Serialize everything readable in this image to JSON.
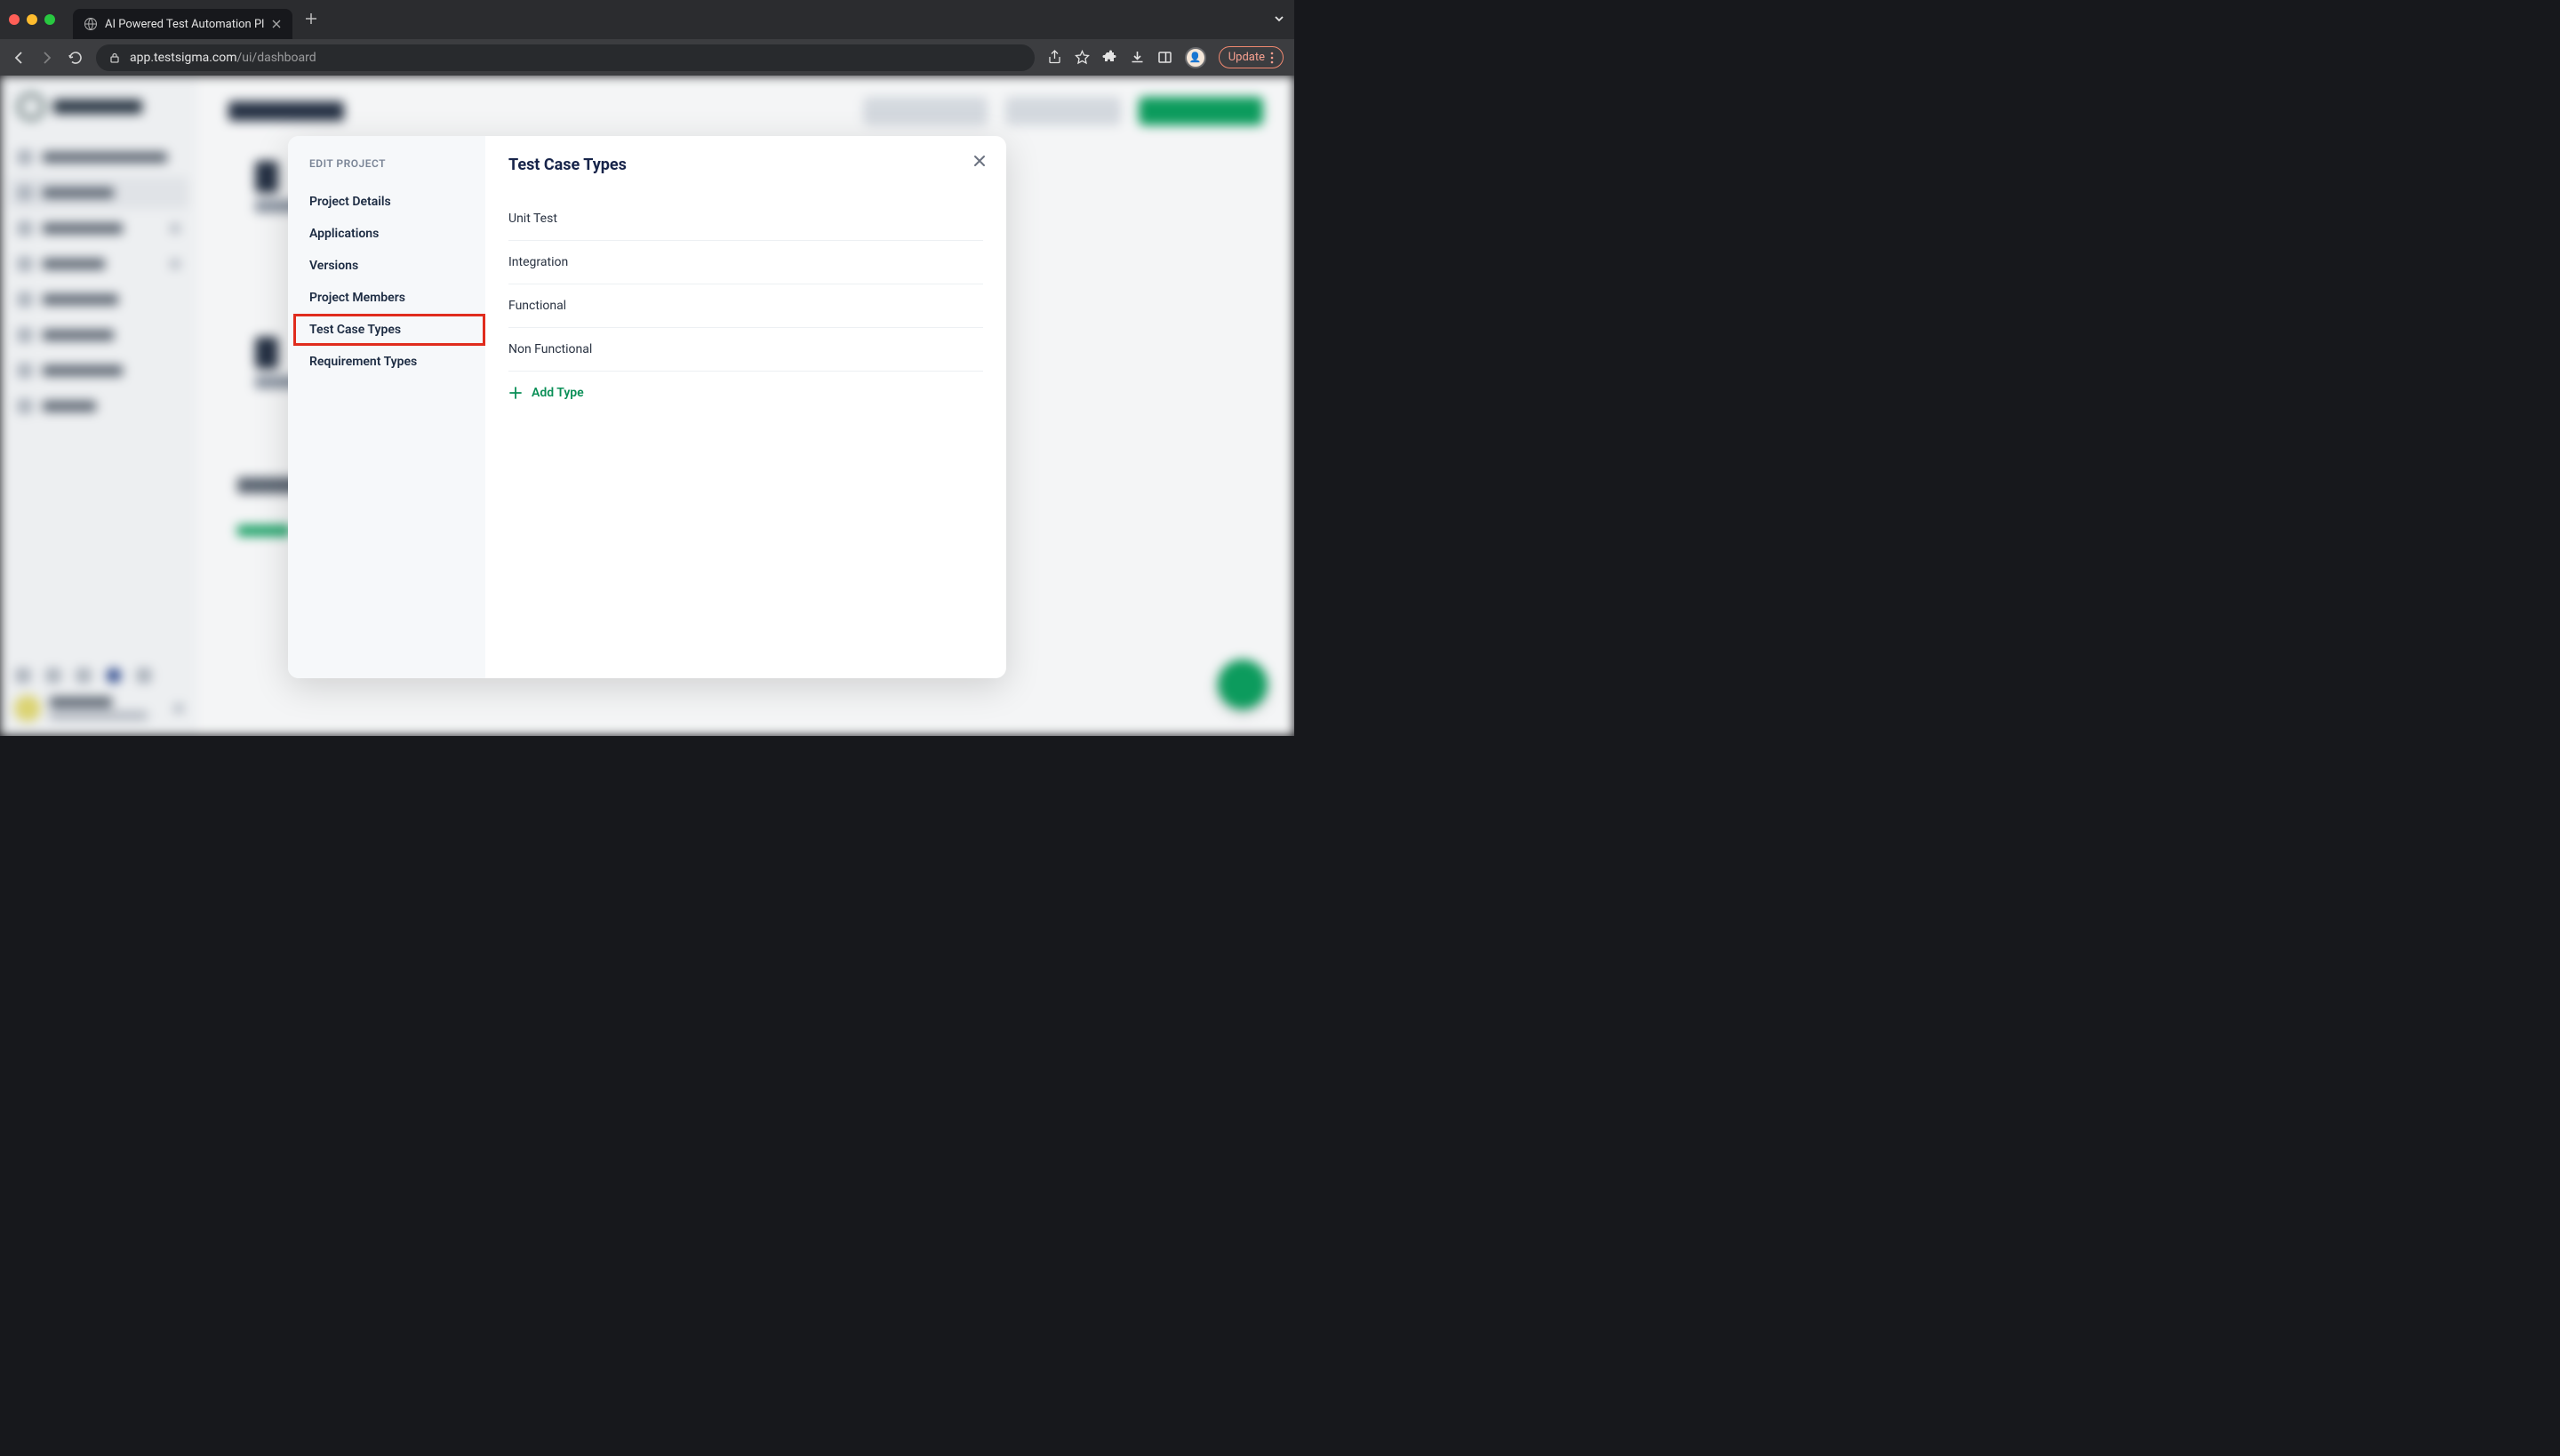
{
  "browser": {
    "tab_title": "AI Powered Test Automation Pl",
    "url_host": "app.testsigma.com",
    "url_path": "/ui/dashboard",
    "update_label": "Update"
  },
  "modal": {
    "sidebar_title": "EDIT PROJECT",
    "nav": [
      "Project Details",
      "Applications",
      "Versions",
      "Project Members",
      "Test Case Types",
      "Requirement Types"
    ],
    "active_nav_index": 4,
    "title": "Test Case Types",
    "types": [
      "Unit Test",
      "Integration",
      "Functional",
      "Non Functional"
    ],
    "add_label": "Add Type"
  }
}
